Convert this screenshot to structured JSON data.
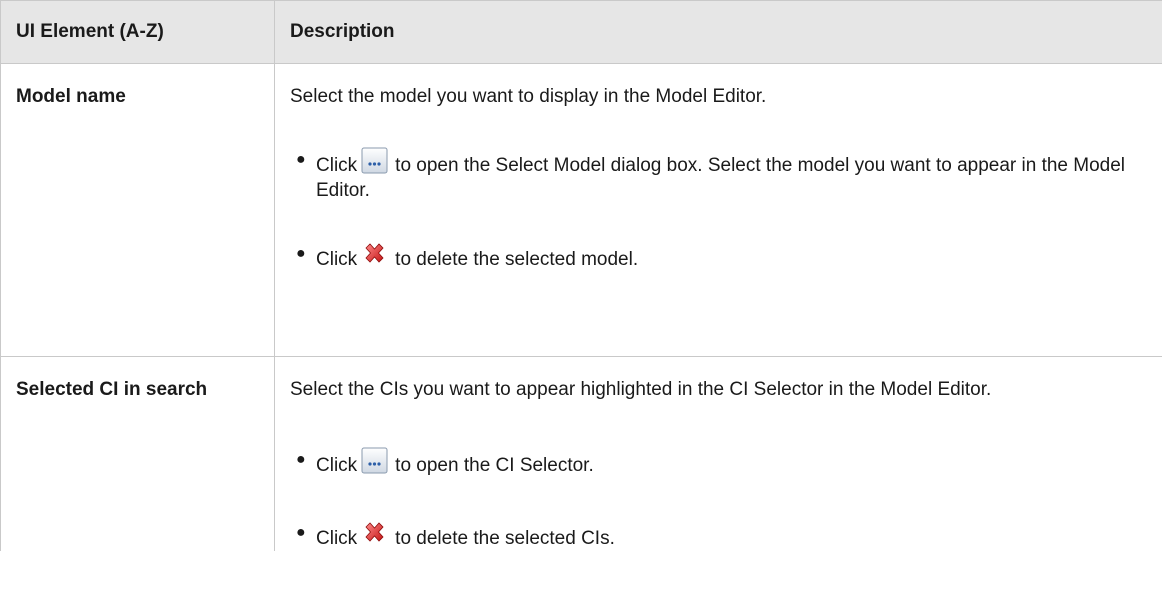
{
  "table": {
    "headers": [
      "UI Element (A-Z)",
      "Description"
    ],
    "rows": [
      {
        "name": "Model name",
        "lead": "Select the model you want to display in the Model Editor.",
        "actions": [
          {
            "prefix": "Click",
            "icon": "browse-ellipsis-icon",
            "text": "to open the Select Model dialog box. Select the model you want to appear in the Model Editor."
          },
          {
            "prefix": "Click",
            "icon": "delete-x-icon",
            "text": "to delete the selected model."
          }
        ]
      },
      {
        "name": "Selected CI in search",
        "lead": "Select the CIs you want to appear highlighted in the CI Selector in the Model Editor.",
        "actions": [
          {
            "prefix": "Click",
            "icon": "browse-ellipsis-icon",
            "text": "to open the CI Selector."
          },
          {
            "prefix": "Click",
            "icon": "delete-x-icon",
            "text": "to delete the selected CIs."
          }
        ]
      }
    ]
  }
}
